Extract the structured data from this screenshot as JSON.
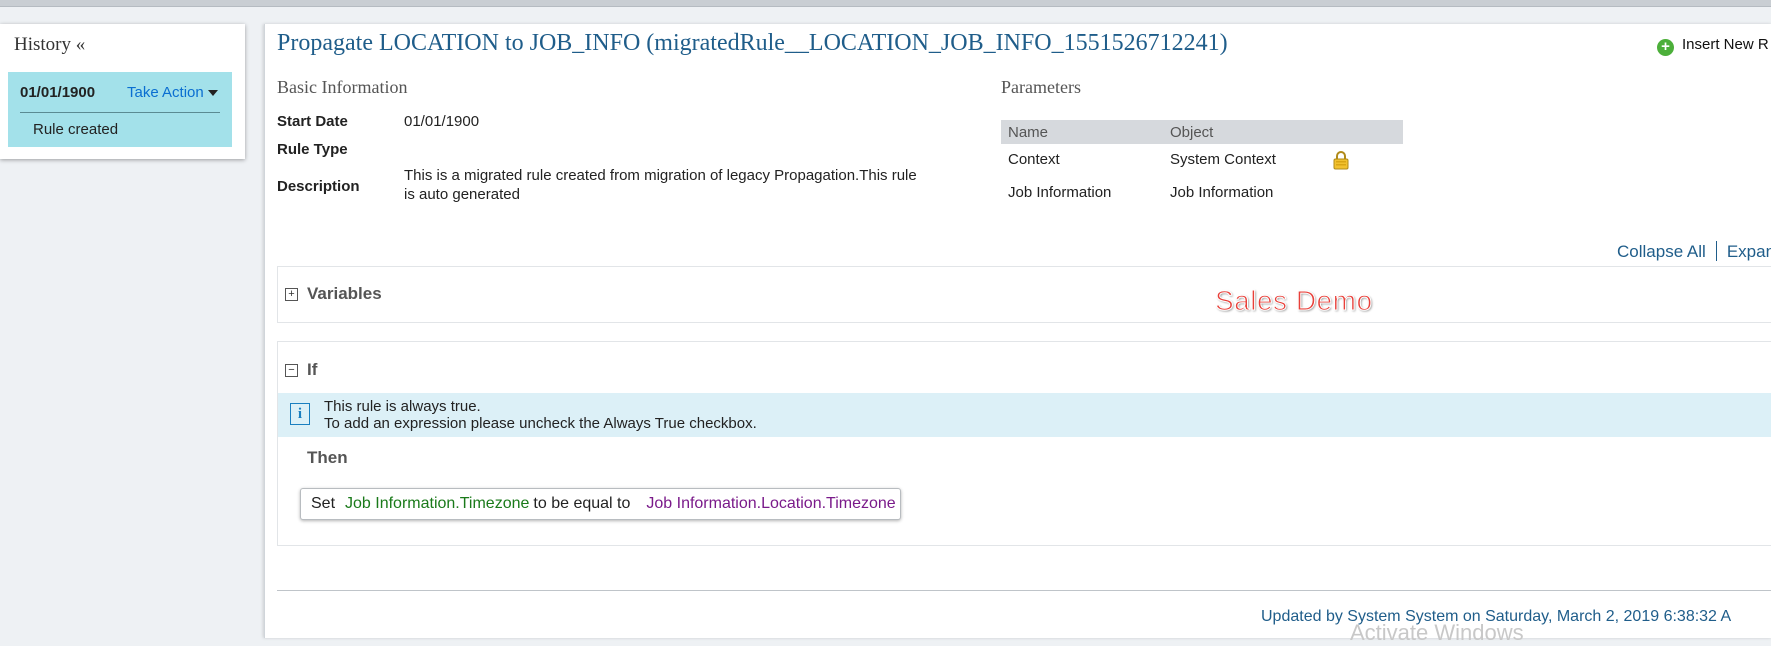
{
  "history": {
    "title": "History «",
    "entry": {
      "date": "01/01/1900",
      "action_label": "Take Action",
      "description": "Rule created"
    }
  },
  "rule": {
    "title": "Propagate LOCATION to JOB_INFO (migratedRule__LOCATION_JOB_INFO_1551526712241)",
    "insert_label": "Insert New R",
    "basic_info": {
      "heading": "Basic Information",
      "start_date_label": "Start Date",
      "start_date": "01/01/1900",
      "rule_type_label": "Rule Type",
      "rule_type": "",
      "description_label": "Description",
      "description_line1": "This is a migrated rule created from migration of legacy Propagation.This rule",
      "description_line2": "is auto generated"
    },
    "parameters": {
      "heading": "Parameters",
      "columns": [
        "Name",
        "Object"
      ],
      "rows": [
        {
          "name": "Context",
          "object": "System Context"
        },
        {
          "name": "Job Information",
          "object": "Job Information"
        }
      ]
    },
    "collapse_all": "Collapse All",
    "expand_all": "Expan",
    "variables_label": "Variables",
    "if_label": "If",
    "info_line1": "This rule is always true.",
    "info_line2": "To add an expression please uncheck the Always True checkbox.",
    "then_label": "Then",
    "set_statement": {
      "set": "Set",
      "target": "Job Information.Timezone",
      "op": "to be equal to",
      "source": "Job Information.Location.Timezone"
    },
    "updated": "Updated by System System on Saturday, March 2, 2019 6:38:32 A"
  },
  "watermark": "Sales Demo",
  "os_overlay": "Activate Windows",
  "colors": {
    "title": "#1f5d8a",
    "history_card": "#a3e1ea",
    "link": "#0a6ed1",
    "info_strip": "#dcf0f7",
    "target_field": "#1a7a1a",
    "source_field": "#7a1a8a",
    "watermark": "#e8403a"
  },
  "icons": [
    "add-circle-icon",
    "lock-icon",
    "expand-icon",
    "collapse-icon",
    "info-icon",
    "caret-down-icon"
  ]
}
